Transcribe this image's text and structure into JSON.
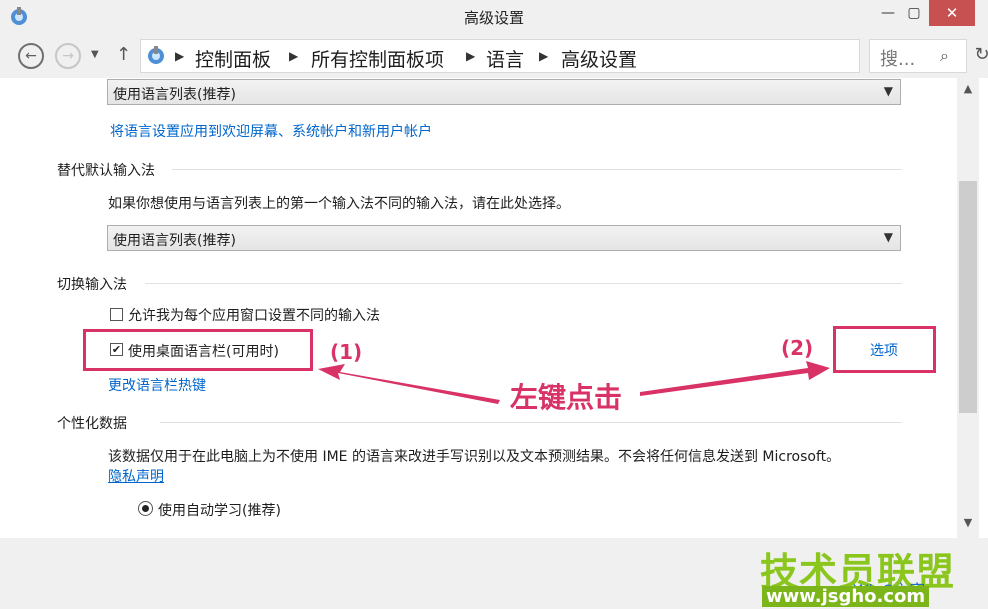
{
  "window": {
    "title": "高级设置",
    "minimize": "—",
    "maximize": "▢",
    "close": "✕"
  },
  "nav": {
    "breadcrumbs": [
      "控制面板",
      "所有控制面板项",
      "语言",
      "高级设置"
    ],
    "separator": "▶",
    "search_placeholder": "搜...",
    "icons": {
      "back": "back-arrow-icon",
      "forward": "forward-arrow-icon",
      "up": "up-arrow-icon",
      "refresh": "refresh-icon",
      "search": "search-icon"
    }
  },
  "content": {
    "top_select_value": "使用语言列表(推荐)",
    "apply_link": "将语言设置应用到欢迎屏幕、系统帐户和新用户帐户",
    "override_section": "替代默认输入法",
    "override_desc": "如果你想使用与语言列表上的第一个输入法不同的输入法，请在此处选择。",
    "override_select_value": "使用语言列表(推荐)",
    "switch_section": "切换输入法",
    "cb_per_app": {
      "label": "允许我为每个应用窗口设置不同的输入法",
      "checked": false
    },
    "cb_langbar": {
      "label": "使用桌面语言栏(可用时)",
      "checked": true
    },
    "options_link": "选项",
    "hotkeys_link": "更改语言栏热键",
    "personal_section": "个性化数据",
    "personal_desc": "该数据仅用于在此电脑上为不使用 IME 的语言来改进手写识别以及文本预测结果。不会将任何信息发送到 Microsoft。",
    "privacy_link": "隐私声明",
    "radio_auto": "使用自动学习(推荐)"
  },
  "annotations": {
    "label1": "(1)",
    "label2": "(2)",
    "callout": "左键点击",
    "color": "#d83266"
  },
  "watermark": {
    "brand": "技术员联盟",
    "site": "www.jsgho.com",
    "sub": "Win8之家"
  }
}
